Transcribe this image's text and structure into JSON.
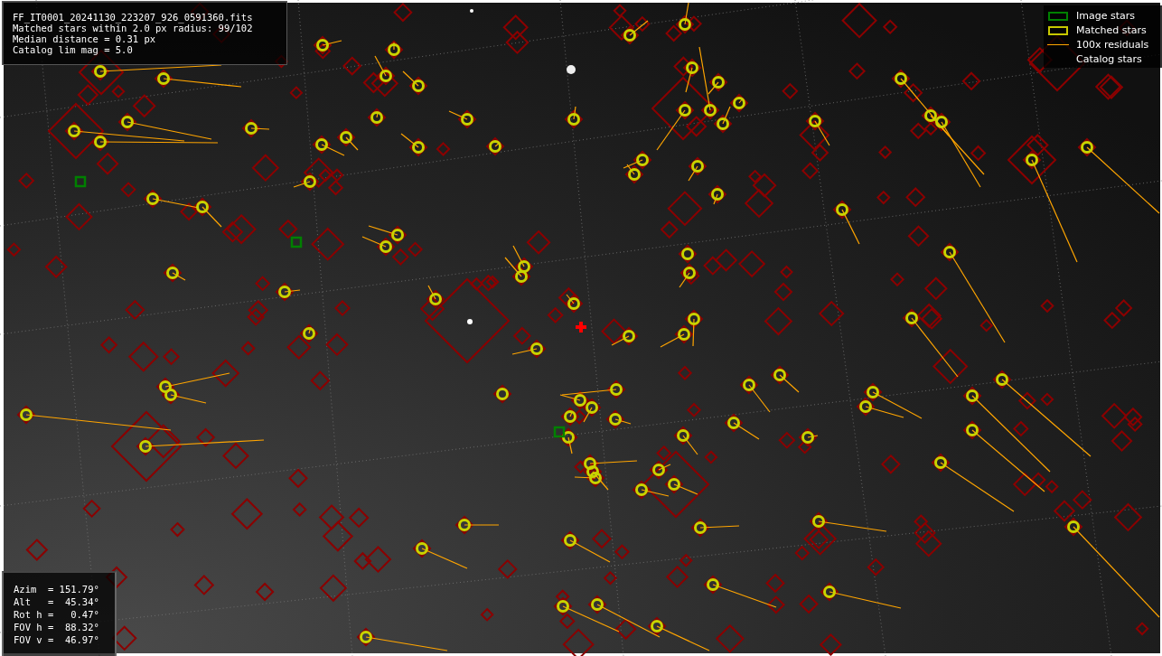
{
  "info_box": {
    "lines": [
      "FF_IT0001_20241130_223207_926_0591360.fits",
      "Matched stars within 2.0 px radius: 99/102",
      "Median distance = 0.31 px",
      "Catalog lim mag = 5.0"
    ]
  },
  "legend": {
    "items": [
      {
        "label": "Image stars",
        "kind": "box",
        "color": "#008000"
      },
      {
        "label": "Matched stars",
        "kind": "box",
        "color": "#c8c800"
      },
      {
        "label": "100x residuals",
        "kind": "line",
        "color": "#ffa500"
      },
      {
        "label": "Catalog stars",
        "kind": "blank"
      }
    ]
  },
  "pointing_box": {
    "lines": [
      "Azim  = 151.79°",
      "Alt   =  45.34°",
      "Rot h =   0.47°",
      "FOV h =  88.32°",
      "FOV v =  46.97°"
    ]
  }
}
